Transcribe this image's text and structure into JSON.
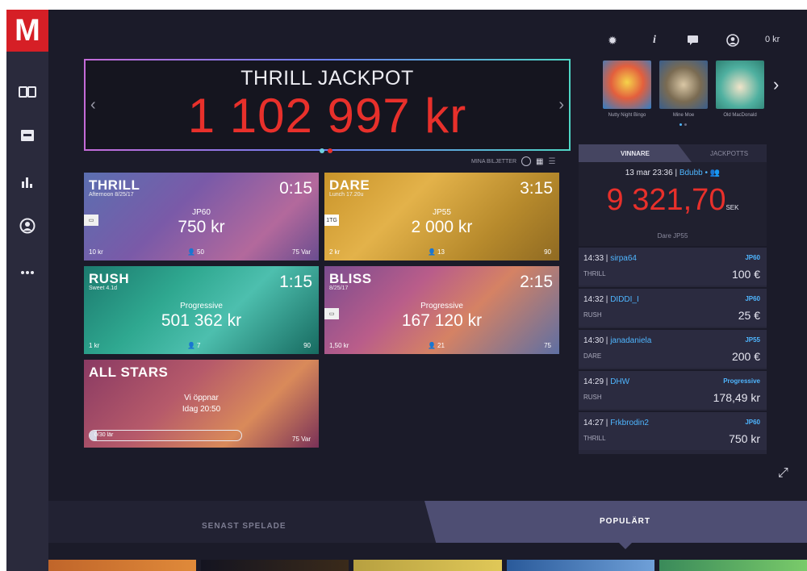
{
  "logo": "M",
  "topbar": {
    "balance": "0 kr"
  },
  "jackpot": {
    "title": "THRILL JACKPOT",
    "amount": "1 102 997 kr"
  },
  "tickets_label": "MINA BILJETTER",
  "tiles": [
    {
      "name": "THRILL",
      "sub": "Afternoon 8/25/17",
      "timer": "0:15",
      "label": "JP60",
      "amount": "750 kr",
      "stake": "10 kr",
      "players": "50",
      "info": "75 Var",
      "badge": ""
    },
    {
      "name": "DARE",
      "sub": "Lunch 17.20u",
      "timer": "3:15",
      "label": "JP55",
      "amount": "2 000 kr",
      "stake": "2 kr",
      "players": "13",
      "info": "90",
      "badge": "1TG"
    },
    {
      "name": "RUSH",
      "sub": "Sweet 4.1d",
      "timer": "1:15",
      "label": "Progressive",
      "amount": "501 362 kr",
      "stake": "1 kr",
      "players": "7",
      "info": "90",
      "badge": ""
    },
    {
      "name": "BLISS",
      "sub": "8/25/17",
      "timer": "2:15",
      "label": "Progressive",
      "amount": "167 120 kr",
      "stake": "1,50 kr",
      "players": "21",
      "info": "75",
      "badge": ""
    },
    {
      "name": "ALL STARS",
      "line1": "Vi öppnar",
      "line2": "Idag 20:50",
      "progress": "0/30 lär",
      "info": "75 Var",
      "progress_fraction": 0.05
    }
  ],
  "games": [
    {
      "name": "Nutty Night Bingo"
    },
    {
      "name": "Mine Moe"
    },
    {
      "name": "Old MacDonald"
    }
  ],
  "panel": {
    "tab_winners": "VINNARE",
    "tab_jackpots": "JACKPOTTS",
    "latest": {
      "date": "13 mar 23:36 | ",
      "user": "Bdubb",
      "amount": "9 321,70",
      "currency": "SEK",
      "game": "Dare JP55"
    },
    "winners": [
      {
        "time": "14:33 | ",
        "user": "sirpa64",
        "type": "JP60",
        "game": "THRILL",
        "amount": "100 €"
      },
      {
        "time": "14:32 | ",
        "user": "DIDDI_I",
        "type": "JP60",
        "game": "RUSH",
        "amount": "25 €"
      },
      {
        "time": "14:30 | ",
        "user": "janadaniela",
        "type": "JP55",
        "game": "DARE",
        "amount": "200 €"
      },
      {
        "time": "14:29 | ",
        "user": "DHW",
        "type": "Progressive",
        "game": "RUSH",
        "amount": "178,49 kr"
      },
      {
        "time": "14:27 | ",
        "user": "Frkbrodin2",
        "type": "JP60",
        "game": "THRILL",
        "amount": "750 kr"
      }
    ]
  },
  "bottom": {
    "recent": "SENAST SPELADE",
    "popular": "POPULÄRT"
  },
  "colors": {
    "accent_red": "#d61f26",
    "amount_red": "#e8302b",
    "link_blue": "#4fb6ff"
  }
}
